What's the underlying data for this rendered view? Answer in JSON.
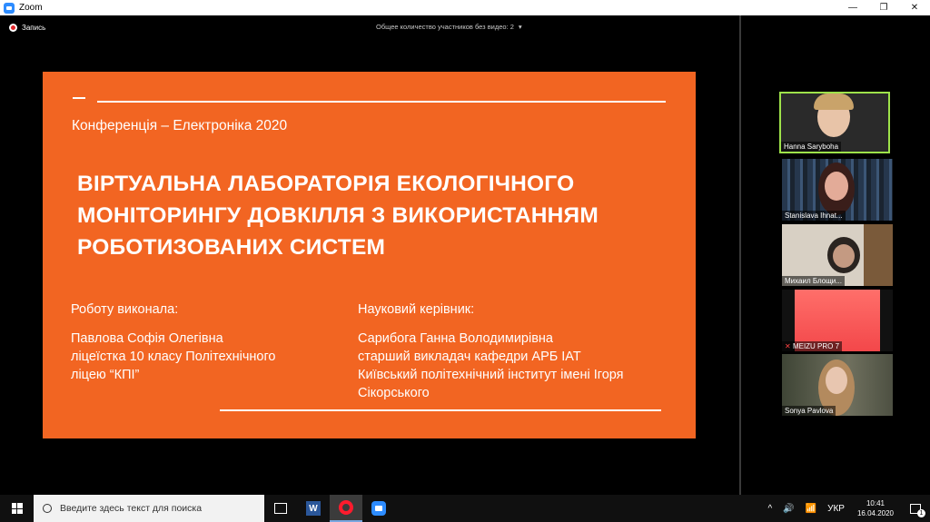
{
  "window": {
    "title": "Zoom",
    "minimize": "—",
    "restore": "❐",
    "close": "✕"
  },
  "meeting": {
    "recording_label": "Запись",
    "no_video_text": "Общее количество участников без видео: 2",
    "no_video_chevron": "▾"
  },
  "slide": {
    "conference": "Конференція – Електроніка 2020",
    "title_lines": [
      "ВІРТУАЛЬНА ЛАБОРАТОРІЯ ЕКОЛОГІЧНОГО",
      "МОНІТОРИНГУ ДОВКІЛЛЯ З ВИКОРИСТАННЯМ",
      "РОБОТИЗОВАНИХ СИСТЕМ"
    ],
    "left_heading": "Роботу виконала:",
    "left_lines": [
      "Павлова Софія Олегівна",
      "ліцеїстка 10 класу Політехнічного",
      "ліцею “КПІ”"
    ],
    "right_heading": "Науковий керівник:",
    "right_lines": [
      "Сарибога Ганна Володимирівна",
      "старший викладач кафедри АРБ ІАТ",
      "Київський політехнічний інститут імені Ігоря",
      "Сікорського"
    ]
  },
  "participants": [
    {
      "name": "Hanna Saryboha"
    },
    {
      "name": "Stanislava Ihnat..."
    },
    {
      "name": "Михаил Блощи..."
    },
    {
      "name": "MEIZU PRO 7"
    },
    {
      "name": "Sonya Pavlova"
    }
  ],
  "taskbar": {
    "search_placeholder": "Введите здесь текст для поиска",
    "word_letter": "W",
    "tray_chevron": "^",
    "volume_icon": "🔊",
    "network_icon": "📶",
    "language": "УКР",
    "time": "10:41",
    "date": "16.04.2020",
    "notification_count": "1"
  }
}
